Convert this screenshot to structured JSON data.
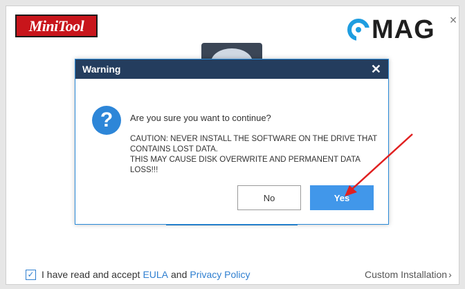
{
  "installer": {
    "brand_logo_text": "MiniTool",
    "watermark_text": "MAG",
    "eula_prefix": "I have read and accept",
    "eula_link": "EULA",
    "eula_and": "and",
    "privacy_link": "Privacy Policy",
    "custom_installation": "Custom Installation",
    "chevron": "›",
    "close_glyph": "×"
  },
  "dialog": {
    "title": "Warning",
    "close_glyph": "✕",
    "question": "Are you sure you want to continue?",
    "caution_lines": [
      "CAUTION: NEVER INSTALL THE SOFTWARE ON THE DRIVE THAT",
      "CONTAINS LOST DATA.",
      "THIS MAY CAUSE DISK OVERWRITE AND PERMANENT DATA",
      "LOSS!!!"
    ],
    "no_label": "No",
    "yes_label": "Yes"
  },
  "colors": {
    "accent_blue": "#4197ea",
    "header_navy": "#243d5e",
    "brand_red": "#c8151b",
    "annotation_red": "#e02020"
  },
  "icons": {
    "question": "question-mark-icon",
    "checkbox": "checkmark-icon",
    "watermark": "c-mag-logo-icon"
  }
}
